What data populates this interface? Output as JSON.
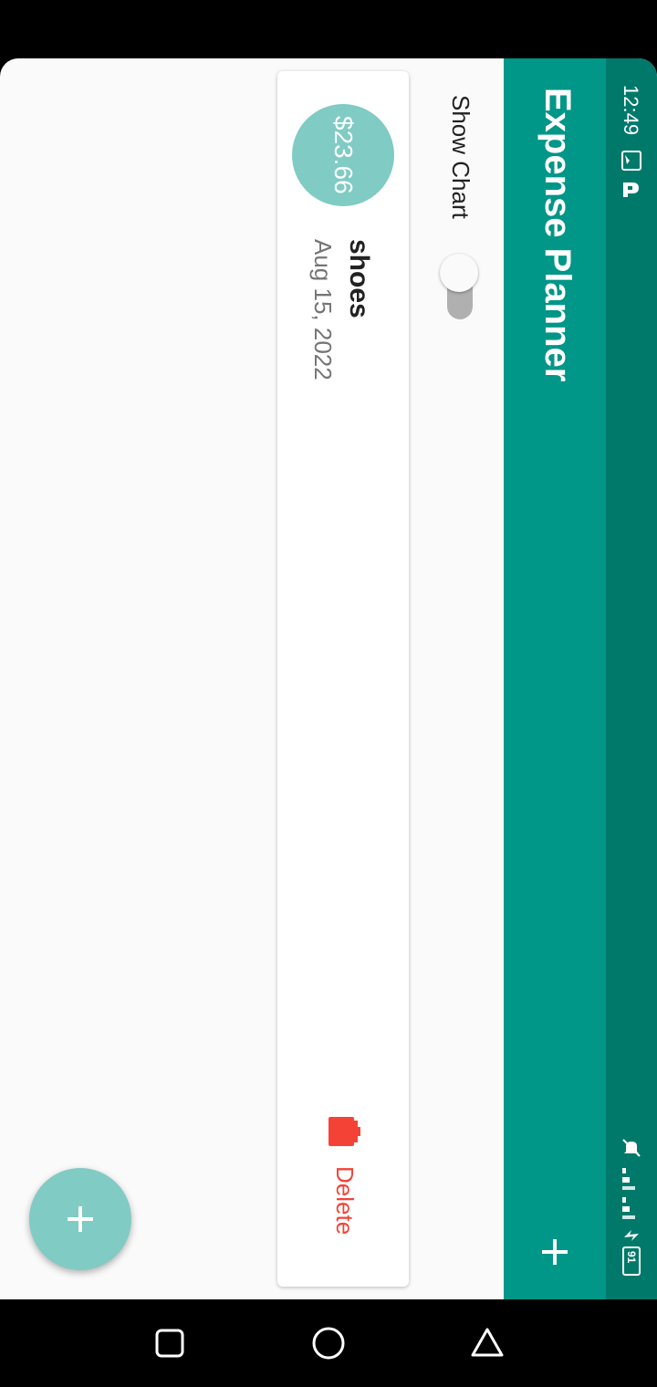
{
  "status_bar": {
    "time": "12:49",
    "battery": "91",
    "color": "#00796b"
  },
  "app_bar": {
    "title": "Expense Planner",
    "add_icon": "plus-icon",
    "color": "#009688"
  },
  "controls": {
    "show_chart_label": "Show Chart",
    "show_chart_on": false
  },
  "transactions": [
    {
      "amount": "$23.66",
      "title": "shoes",
      "date": "Aug 15, 2022",
      "delete_label": "Delete"
    }
  ],
  "fab": {
    "icon": "plus-icon",
    "color": "#80cbc4"
  },
  "nav_bar": {
    "icons": [
      "recent-apps-icon",
      "home-icon",
      "back-icon"
    ]
  }
}
